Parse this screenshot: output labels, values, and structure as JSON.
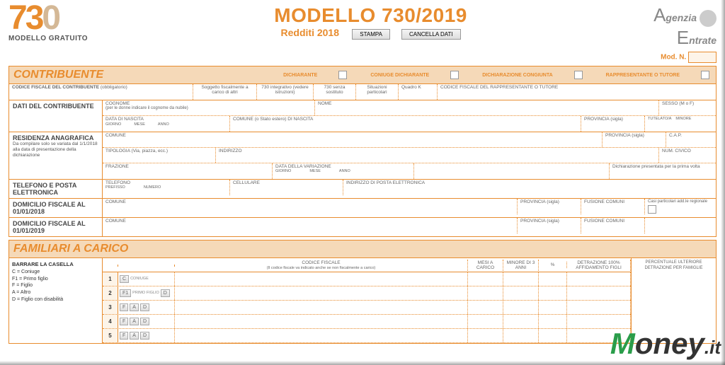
{
  "header": {
    "logo_num": "730",
    "logo_sub": "MODELLO GRATUITO",
    "title": "MODELLO 730/2019",
    "subtitle": "Redditi 2018",
    "btn_print": "STAMPA",
    "btn_clear": "CANCELLA DATI",
    "agenzia1": "genzia",
    "agenzia2": "ntrate",
    "modn": "Mod. N."
  },
  "sec1": {
    "title": "CONTRIBUENTE",
    "chk1": "DICHIARANTE",
    "chk2": "CONIUGE DICHIARANTE",
    "chk3": "DICHIARAZIONE CONGIUNTA",
    "chk4": "RAPPRESENTANTE O TUTORE"
  },
  "r1": {
    "l1": "CODICE FISCALE DEL CONTRIBUENTE",
    "l1s": "(obbligatorio)",
    "c1": "Soggetto fiscalmente a carico di altri",
    "c2": "730 integrativo (vedere istruzioni)",
    "c3": "730 senza sostituto",
    "c4": "Situazioni particolari",
    "c5": "Quadro K",
    "c6": "CODICE FISCALE DEL RAPPRESENTANTE O TUTORE"
  },
  "r2": {
    "side": "DATI DEL CONTRIBUENTE",
    "cognome": "COGNOME",
    "cognome_s": "(per le donne indicare il cognome da nubile)",
    "nome": "NOME",
    "sesso": "SESSO (M o F)",
    "datan": "DATA DI NASCITA",
    "g": "GIORNO",
    "m": "MESE",
    "a": "ANNO",
    "comune_n": "COMUNE (o Stato estero) DI NASCITA",
    "prov": "PROVINCIA (sigla)",
    "tut": "TUTELATO/A",
    "min": "MINORE"
  },
  "r3": {
    "side": "RESIDENZA ANAGRAFICA",
    "side_s": "Da compilare solo se variata dal 1/1/2018 alla data di presentazione della dichiarazione",
    "comune": "COMUNE",
    "prov": "PROVINCIA (sigla)",
    "cap": "C.A.P.",
    "tip": "TIPOLOGIA (Via, piazza, ecc.)",
    "ind": "INDIRIZZO",
    "nc": "NUM. CIVICO",
    "fraz": "FRAZIONE",
    "datav": "DATA DELLA VARIAZIONE",
    "g": "GIORNO",
    "m": "MESE",
    "a": "ANNO",
    "dich": "Dichiarazione presentata per la prima volta"
  },
  "r4": {
    "side": "TELEFONO E POSTA ELETTRONICA",
    "tel": "TELEFONO",
    "pref": "PREFISSO",
    "num": "NUMERO",
    "cel": "CELLULARE",
    "email": "INDIRIZZO DI POSTA ELETTRONICA"
  },
  "r5": {
    "side": "DOMICILIO FISCALE AL 01/01/2018",
    "comune": "COMUNE",
    "prov": "PROVINCIA (sigla)",
    "fus": "FUSIONE COMUNI",
    "casi": "Casi particolari add.le regionale"
  },
  "r6": {
    "side": "DOMICILIO FISCALE AL 01/01/2019",
    "comune": "COMUNE",
    "prov": "PROVINCIA (sigla)",
    "fus": "FUSIONE COMUNI"
  },
  "sec2": {
    "title": "FAMILIARI A CARICO"
  },
  "fam": {
    "barr": "BARRARE LA CASELLA",
    "leg_c": "C = Coniuge",
    "leg_f1": "F1 = Primo figlio",
    "leg_f": "F = Figlio",
    "leg_a": "A = Altro",
    "leg_d": "D = Figlio con disabilità",
    "hdr_cf": "CODICE FISCALE",
    "hdr_cf_s": "(Il codice fiscale va indicato anche se non fiscalmente a carico)",
    "hdr_mesi": "MESI A CARICO",
    "hdr_min": "MINORE DI 3 ANNI",
    "hdr_pct": "%",
    "hdr_det": "DETRAZIONE 100% AFFIDAMENTO FIGLI",
    "right": "PERCENTUALE ULTERIORE DETRAZIONE PER FAMIGLIE",
    "row1_c": "C",
    "row1_con": "CONIUGE",
    "row2_f1": "F1",
    "row2_pf": "PRIMO FIGLIO",
    "row2_d": "D",
    "f": "F",
    "a": "A",
    "d": "D",
    "n1": "1",
    "n2": "2",
    "n3": "3",
    "n4": "4",
    "n5": "5"
  },
  "wm": {
    "m": "M",
    "oney": "oney",
    "it": ".it"
  }
}
